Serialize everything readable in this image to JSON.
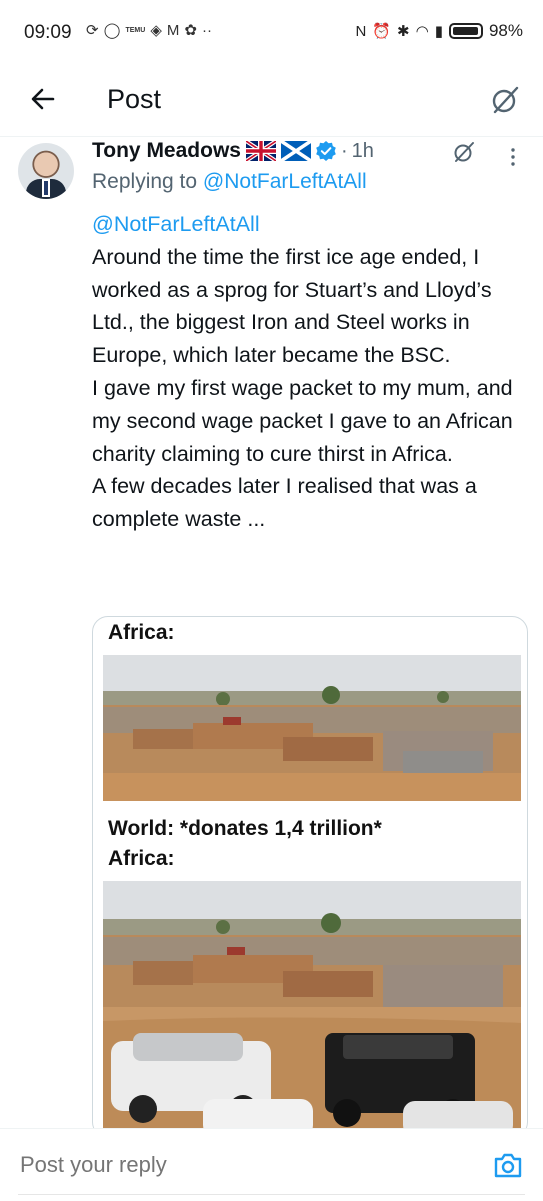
{
  "status_bar": {
    "time": "09:09",
    "temu": "TEMU",
    "battery": "98%",
    "battery_level": 0.98
  },
  "header": {
    "title": "Post"
  },
  "tweet": {
    "author": "Tony Meadows",
    "time": "1h",
    "separator": "·",
    "replying_prefix": "Replying to",
    "replying_handle": "@NotFarLeftAtAll",
    "mention": "@NotFarLeftAtAll",
    "body_lines": [
      "Around the time the first ice age ended, I worked as a sprog for Stuart’s and Lloyd’s Ltd., the biggest Iron and Steel works in Europe, which later became the BSC.",
      "I gave my first wage packet to my mum, and my second wage packet I gave to an African charity claiming to cure thirst in Africa.",
      "A few decades later I realised that was a complete waste ..."
    ]
  },
  "meme": {
    "label_1": "Africa:",
    "label_2": "World: *donates 1,4 trillion*",
    "label_3": "Africa:"
  },
  "reply_bar": {
    "placeholder": "Post your reply"
  },
  "icons": [
    "back-arrow-icon",
    "grok-icon",
    "verified-badge-icon",
    "more-icon",
    "camera-icon",
    "uk-flag-icon",
    "scotland-flag-icon"
  ],
  "colors": {
    "accent": "#1d9bf0",
    "secondary_text": "#536471",
    "primary_text": "#0f1419"
  }
}
